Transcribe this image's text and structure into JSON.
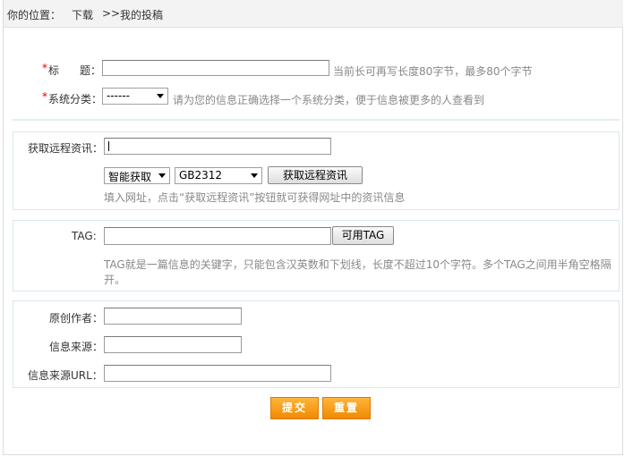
{
  "breadcrumb": {
    "prefix": "你的位置：",
    "link": "下载",
    "separator": ">>",
    "current": "我的投稿"
  },
  "form": {
    "title": {
      "required_mark": "*",
      "label_a": "标",
      "label_b": "题：",
      "value": "",
      "hint": "当前长可再写长度80字节，最多80个字节"
    },
    "category": {
      "required_mark": "*",
      "label": "系统分类：",
      "selected": "------",
      "hint": "请为您的信息正确选择一个系统分类，便于信息被更多的人查看到"
    },
    "remote": {
      "label": "获取远程资讯：",
      "url_value": "",
      "mode_selected": "智能获取",
      "charset_selected": "GB2312",
      "button": "获取远程资讯",
      "hint": "填入网址，点击“获取远程资讯”按钮就可获得网址中的资讯信息"
    },
    "tag": {
      "label": "TAG:",
      "value": "",
      "button": "可用TAG",
      "hint_line1": "TAG就是一篇信息的关键字，只能包含汉英数和下划线，长度不超过10个字符。多个TAG之间用半角空格隔",
      "hint_line2": "开。"
    },
    "source": {
      "author_label": "原创作者：",
      "author_value": "",
      "origin_label": "信息来源：",
      "origin_value": "",
      "url_label": "信息来源URL：",
      "url_value": ""
    },
    "actions": {
      "submit": "提交",
      "reset": "重置"
    }
  },
  "colors": {
    "accent_orange": "#f39800",
    "required_red": "#d40000",
    "section_border": "#d7e9ee"
  }
}
